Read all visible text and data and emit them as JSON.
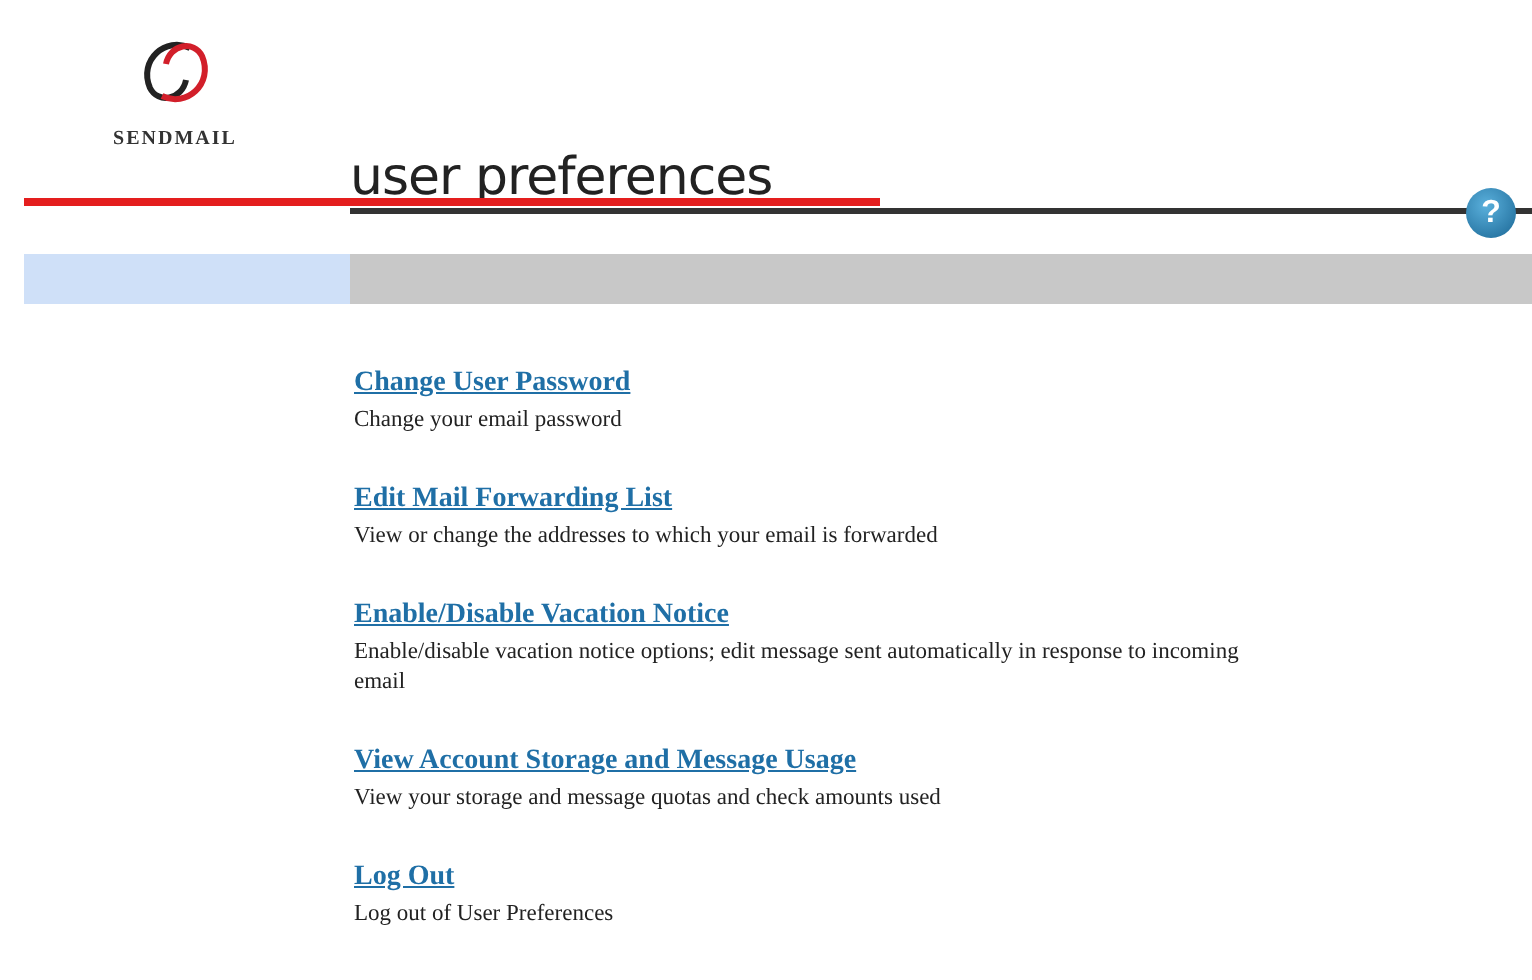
{
  "logo": {
    "text": "SENDMAIL"
  },
  "title": "user preferences",
  "help": {
    "symbol": "?"
  },
  "items": [
    {
      "link": "Change User Password",
      "description": "Change your email password"
    },
    {
      "link": "Edit Mail Forwarding List",
      "description": "View or change the addresses to which your email is forwarded"
    },
    {
      "link": "Enable/Disable Vacation Notice",
      "description": "Enable/disable vacation notice options; edit message sent automatically in response to incoming email"
    },
    {
      "link": "View Account Storage and Message Usage",
      "description": "View your storage and message quotas and check amounts used"
    },
    {
      "link": "Log Out",
      "description": "Log out of User Preferences"
    }
  ]
}
